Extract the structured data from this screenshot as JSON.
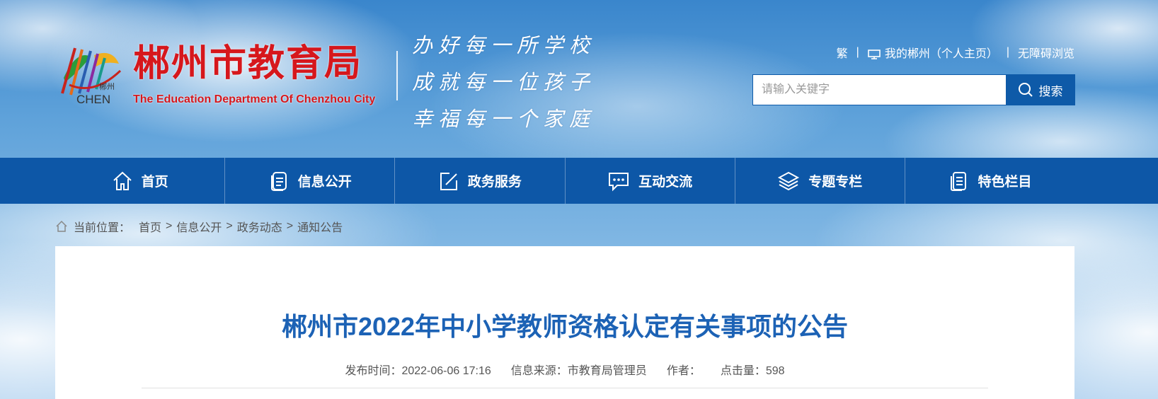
{
  "header": {
    "site_title": "郴州市教育局",
    "site_subtitle": "The Education Department Of Chenzhou City",
    "logo_text_cn": "郴州",
    "logo_text_en": "CHEN",
    "slogan": [
      "办好每一所学校",
      "成就每一位孩子",
      "幸福每一个家庭"
    ],
    "links": {
      "traditional": "繁",
      "my_chenzhou": "我的郴州（个人主页）",
      "accessibility": "无障碍浏览"
    },
    "search": {
      "placeholder": "请输入关键字",
      "button_label": "搜索"
    }
  },
  "nav": {
    "items": [
      {
        "label": "首页",
        "icon": "home-icon"
      },
      {
        "label": "信息公开",
        "icon": "document-icon"
      },
      {
        "label": "政务服务",
        "icon": "edit-icon"
      },
      {
        "label": "互动交流",
        "icon": "chat-icon"
      },
      {
        "label": "专题专栏",
        "icon": "layers-icon"
      },
      {
        "label": "特色栏目",
        "icon": "list-icon"
      }
    ]
  },
  "breadcrumb": {
    "lead": "当前位置：",
    "items": [
      "首页",
      "信息公开",
      "政务动态",
      "通知公告"
    ],
    "separator": ">"
  },
  "article": {
    "title": "郴州市2022年中小学教师资格认定有关事项的公告",
    "publish_time": "发布时间：2022-06-06 17:16",
    "source": "信息来源：市教育局管理员",
    "author": "作者：",
    "clicks": "点击量：598"
  },
  "colors": {
    "brand_blue": "#0d57a7",
    "title_red": "#d6171c",
    "article_title_blue": "#1c62b5"
  }
}
